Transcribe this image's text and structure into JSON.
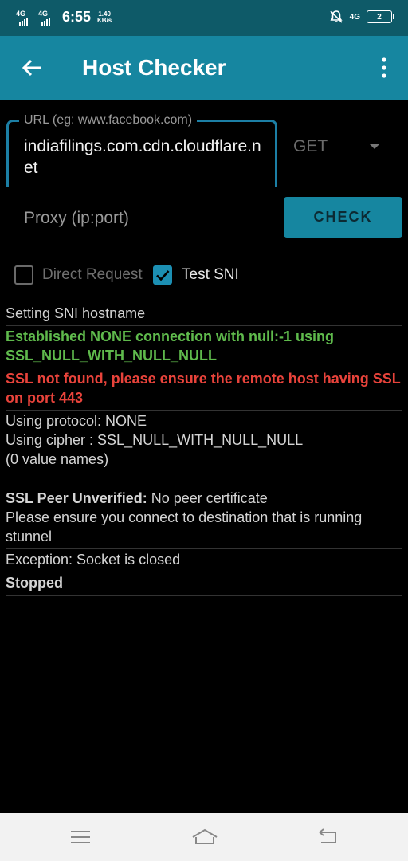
{
  "status_bar": {
    "sim1": "4G",
    "sim2": "4G",
    "time": "6:55",
    "speed_value": "1.40",
    "speed_unit": "KB/s",
    "net": "4G",
    "battery": "2"
  },
  "toolbar": {
    "title": "Host Checker",
    "back_icon": "arrow-left-icon",
    "menu_icon": "more-vert-icon"
  },
  "form": {
    "url_label": "URL (eg: www.facebook.com)",
    "url_value": "indiafilings.com.cdn.cloudflare.net",
    "method": "GET",
    "proxy_placeholder": "Proxy (ip:port)",
    "check_label": "CHECK",
    "direct_request_label": "Direct Request",
    "direct_request_checked": false,
    "test_sni_label": "Test SNI",
    "test_sni_checked": true
  },
  "log": {
    "l1": "Setting SNI hostname",
    "l2": "Established NONE connection with null:-1 using SSL_NULL_WITH_NULL_NULL",
    "l3": "SSL not found, please ensure the remote host having SSL on port 443",
    "l4a": "Using protocol: NONE",
    "l4b": "Using cipher : SSL_NULL_WITH_NULL_NULL",
    "l4c": "(0 value names)",
    "l5a_bold": "SSL Peer Unverified:",
    "l5a_rest": " No peer certificate",
    "l5b": "Please ensure you connect to destination that is running stunnel",
    "l6": "Exception: Socket is closed",
    "l7": "Stopped"
  },
  "colors": {
    "status_bar": "#0e5a68",
    "toolbar": "#1686a0",
    "success": "#5fba4c",
    "error": "#e8433b"
  }
}
